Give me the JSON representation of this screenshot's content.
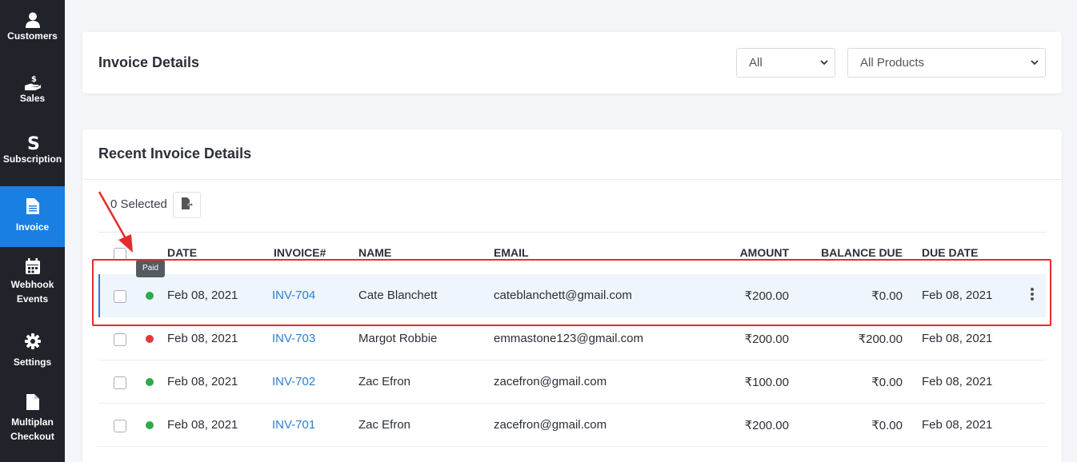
{
  "sidebar": {
    "items": [
      {
        "label": "Customers",
        "icon": "user-icon"
      },
      {
        "label": "Sales",
        "icon": "hand-dollar-icon"
      },
      {
        "label": "Subscription",
        "icon": "s-logo-icon"
      },
      {
        "label": "Invoice",
        "icon": "file-icon",
        "active": true
      },
      {
        "label": "Webhook\nEvents",
        "icon": "calendar-icon"
      },
      {
        "label": "Settings",
        "icon": "gear-icon"
      },
      {
        "label": "Multiplan\nCheckout",
        "icon": "file-icon"
      }
    ]
  },
  "invoice_details": {
    "title": "Invoice Details",
    "filter_status": "All",
    "filter_product": "All Products"
  },
  "recent": {
    "title": "Recent Invoice Details",
    "selected_count": "0 Selected",
    "columns": {
      "date": "DATE",
      "invoice": "INVOICE#",
      "name": "NAME",
      "email": "EMAIL",
      "amount": "AMOUNT",
      "balance": "BALANCE DUE",
      "due": "DUE DATE"
    },
    "tooltip": "Paid",
    "rows": [
      {
        "date": "Feb 08, 2021",
        "invoice": "INV-704",
        "name": "Cate Blanchett",
        "email": "cateblanchett@gmail.com",
        "amount": "₹200.00",
        "balance": "₹0.00",
        "due": "Feb 08, 2021",
        "status_color": "#2eaa4a"
      },
      {
        "date": "Feb 08, 2021",
        "invoice": "INV-703",
        "name": "Margot Robbie",
        "email": "emmastone123@gmail.com",
        "amount": "₹200.00",
        "balance": "₹200.00",
        "due": "Feb 08, 2021",
        "status_color": "#e0393e"
      },
      {
        "date": "Feb 08, 2021",
        "invoice": "INV-702",
        "name": "Zac Efron",
        "email": "zacefron@gmail.com",
        "amount": "₹100.00",
        "balance": "₹0.00",
        "due": "Feb 08, 2021",
        "status_color": "#2eaa4a"
      },
      {
        "date": "Feb 08, 2021",
        "invoice": "INV-701",
        "name": "Zac Efron",
        "email": "zacefron@gmail.com",
        "amount": "₹200.00",
        "balance": "₹0.00",
        "due": "Feb 08, 2021",
        "status_color": "#2eaa4a"
      }
    ]
  },
  "colors": {
    "accent": "#1a7fe3",
    "sidebar": "#20232a",
    "annotation": "#e52b2b"
  }
}
